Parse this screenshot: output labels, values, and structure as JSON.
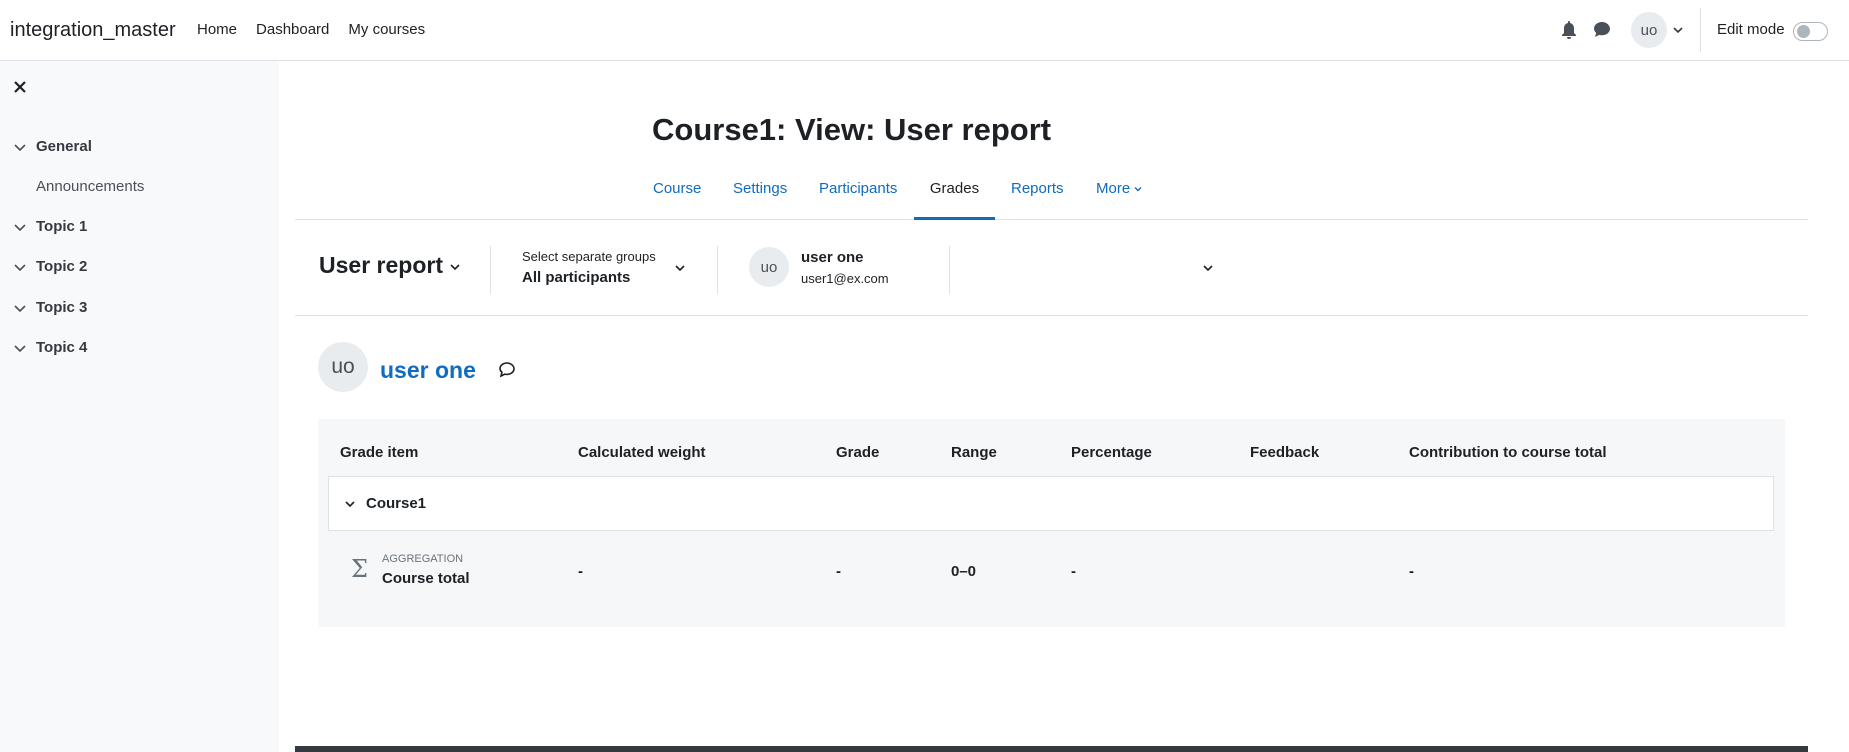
{
  "navbar": {
    "brand": "integration_master",
    "items": [
      "Home",
      "Dashboard",
      "My courses"
    ],
    "avatar_initials": "uo",
    "edit_mode_label": "Edit mode",
    "edit_mode_on": false
  },
  "drawer": {
    "sections": [
      "General",
      "Topic 1",
      "Topic 2",
      "Topic 3",
      "Topic 4"
    ],
    "general_items": [
      "Announcements"
    ]
  },
  "page": {
    "title": "Course1: View: User report",
    "tabs": [
      "Course",
      "Settings",
      "Participants",
      "Grades",
      "Reports",
      "More"
    ],
    "active_tab": "Grades"
  },
  "toolbar": {
    "report": "User report",
    "groups_label": "Select separate groups",
    "groups_value": "All participants",
    "user_initials": "uo",
    "user_name": "user one",
    "user_email": "user1@ex.com"
  },
  "user": {
    "initials": "uo",
    "name": "user one"
  },
  "table": {
    "headers": [
      "Grade item",
      "Calculated weight",
      "Grade",
      "Range",
      "Percentage",
      "Feedback",
      "Contribution to course total"
    ],
    "category": "Course1",
    "total_row": {
      "type_label": "AGGREGATION",
      "name": "Course total",
      "weight": "-",
      "grade": "-",
      "range": "0–0",
      "percentage": "-",
      "feedback": "",
      "contribution": "-"
    }
  },
  "colors": {
    "link": "#0f6cbf",
    "drawer_bg": "#f8f9fa",
    "table_bg": "#f5f7f9"
  }
}
